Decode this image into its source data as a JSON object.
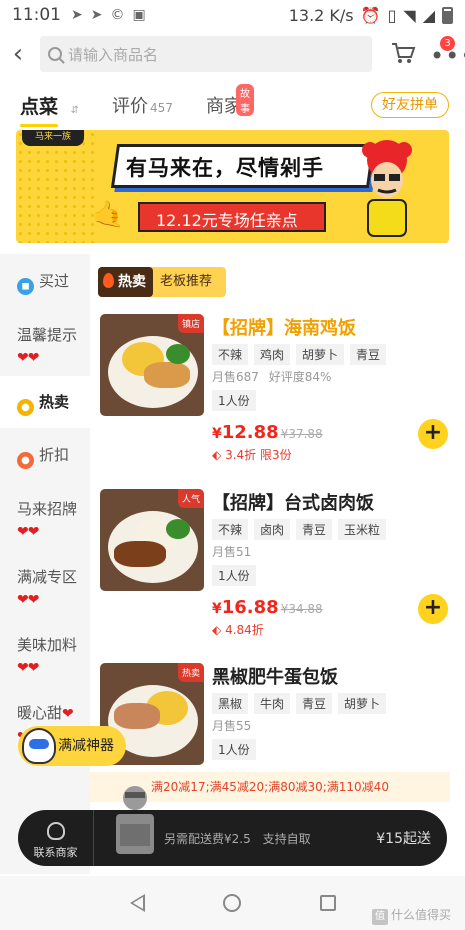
{
  "status_bar": {
    "time": "11:01",
    "network_speed": "13.2 K/s"
  },
  "header": {
    "search_placeholder": "请输入商品名",
    "cart_badge": "3"
  },
  "tabs": [
    {
      "label": "点菜",
      "active": true
    },
    {
      "label": "评价",
      "count": "457"
    },
    {
      "label": "商家",
      "tag": "故事"
    }
  ],
  "group_buy_label": "好友拼单",
  "banner": {
    "logo_text": "马来一族",
    "slogan": "有马来在，尽情剁手",
    "promo": "12.12元专场任亲点"
  },
  "sidebar": {
    "items": [
      {
        "label": "买过",
        "icon": "bag-icon",
        "color": "#3aa0e8"
      },
      {
        "label": "温馨提示",
        "hearts": "❤❤"
      },
      {
        "label": "热卖",
        "icon": "fire-icon",
        "color": "#f5b400",
        "active": true
      },
      {
        "label": "折扣",
        "icon": "discount-icon",
        "color": "#f26b3a"
      },
      {
        "label": "马来招牌",
        "hearts": "❤❤"
      },
      {
        "label": "满减专区",
        "hearts": "❤❤"
      },
      {
        "label": "美味加料",
        "hearts": "❤❤"
      },
      {
        "label": "暖心甜",
        "hearts": "❤❤"
      }
    ]
  },
  "section": {
    "hot_label": "热卖",
    "boss_label": "老板推荐"
  },
  "products": [
    {
      "name": "【招牌】海南鸡饭",
      "image_label": "镇店",
      "tags": [
        "不辣",
        "鸡肉",
        "胡萝卜",
        "青豆"
      ],
      "sales": "月售687",
      "rating": "好评度84%",
      "serving": "1人份",
      "price": "12.88",
      "old_price": "¥37.88",
      "discount": "3.4折 限3份"
    },
    {
      "name": "【招牌】台式卤肉饭",
      "image_label": "人气",
      "tags": [
        "不辣",
        "卤肉",
        "青豆",
        "玉米粒"
      ],
      "sales": "月售51",
      "rating": "",
      "serving": "1人份",
      "price": "16.88",
      "old_price": "¥34.88",
      "discount": "4.84折"
    },
    {
      "name": "黑椒肥牛蛋包饭",
      "image_label": "热卖",
      "tags": [
        "黑椒",
        "牛肉",
        "青豆",
        "胡萝卜"
      ],
      "sales": "月售55",
      "rating": "",
      "serving": "1人份"
    }
  ],
  "promo_strip": "满20减17;满45减20;满80减30;满110减40",
  "floating_button": "满减神器",
  "bottom_bar": {
    "contact": "联系商家",
    "delivery_fee": "另需配送费¥2.5",
    "pickup": "支持自取",
    "min_order": "¥15起送"
  },
  "watermark": "什么值得买",
  "watermark_badge": "值",
  "price_currency": "¥"
}
